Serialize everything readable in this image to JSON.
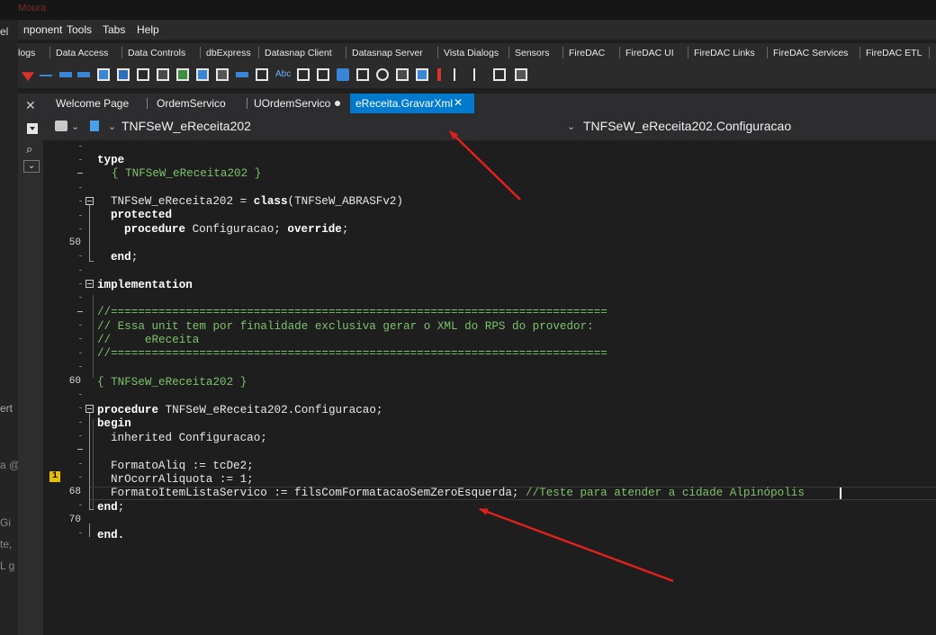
{
  "menubar": {
    "items": [
      "nponent",
      "Tools",
      "Tabs",
      "Help"
    ]
  },
  "palette": {
    "items": [
      "logs",
      "Data Access",
      "Data Controls",
      "dbExpress",
      "Datasnap Client",
      "Datasnap Server",
      "Vista Dialogs",
      "Sensors",
      "FireDAC",
      "FireDAC UI",
      "FireDAC Links",
      "FireDAC Services",
      "FireDAC ETL"
    ]
  },
  "tabs": {
    "items": [
      "Welcome Page",
      "OrdemServico",
      "UOrdemServico",
      "eReceita.GravarXml"
    ],
    "active": "eReceita.GravarXml"
  },
  "navbar": {
    "left_unit": "TNFSeW_eReceita202",
    "right_method": "TNFSeW_eReceita202.Configuracao"
  },
  "gutter": {
    "line_50": "50",
    "line_60": "60",
    "line_68": "68",
    "line_70": "70",
    "bookmark": "1"
  },
  "code": {
    "l1": "type",
    "l2": "{ TNFSeW_eReceita202 }",
    "l4a": "TNFSeW_eReceita202 = ",
    "l4b": "class",
    "l4c": "(TNFSeW_ABRASFv2)",
    "l5": "protected",
    "l6a": "procedure",
    "l6b": " Configuracao; ",
    "l6c": "override",
    "l6d": ";",
    "l8a": "end",
    "l8b": ";",
    "l10": "implementation",
    "l12": "//=========================================================================",
    "l13": "// Essa unit tem por finalidade exclusiva gerar o XML do RPS do provedor:",
    "l14": "//     eReceita",
    "l15": "//=========================================================================",
    "l17": "{ TNFSeW_eReceita202 }",
    "l19a": "procedure",
    "l19b": " TNFSeW_eReceita202.Configuracao;",
    "l20": "begin",
    "l21": "inherited Configuracao;",
    "l23": "FormatoAliq := tcDe2;",
    "l24": "NrOcorrAliquota := 1;",
    "l25a": "FormatoItemListaServico := filsComFormatacaoSemZeroEsquerda; ",
    "l25b": "//Teste para atender a cidade Alpinópolis",
    "l26a": "end",
    "l26b": ";",
    "l28": "end."
  },
  "left_edge_text": {
    "t1": "Moura",
    "t2": "el",
    "t3": "nponent",
    "t4": "ert",
    "t5": "a @",
    "t6": "Gi",
    "t7": "te,",
    "t8": "L g"
  },
  "colors": {
    "accent": "#007acc",
    "arrow": "#e0201a",
    "comment": "#7dc36a"
  }
}
